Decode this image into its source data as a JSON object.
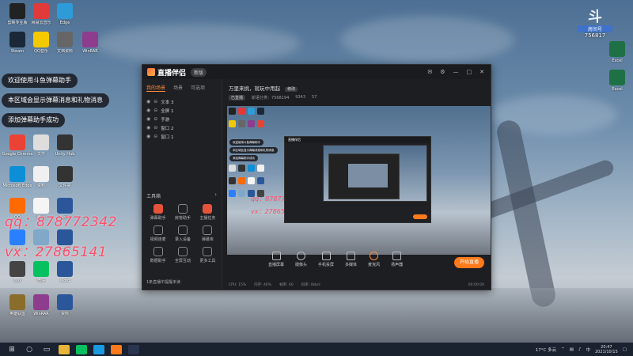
{
  "desktop": {
    "left_icons": [
      {
        "label": "剪映专业版",
        "color": "#222"
      },
      {
        "label": "网易云音乐",
        "color": "#e13a3a"
      },
      {
        "label": "Edge",
        "color": "#2d9bd8"
      },
      {
        "label": "Steam",
        "color": "#1b2838"
      },
      {
        "label": "QQ音乐",
        "color": "#f3c900"
      },
      {
        "label": "文档资料",
        "color": "#666"
      },
      {
        "label": "WinRAR",
        "color": "#8e3c8e"
      },
      {
        "label": "Google Chrome",
        "color": "#ea4335"
      },
      {
        "label": "文件",
        "color": "#ddd"
      },
      {
        "label": "Unity Hub",
        "color": "#333"
      },
      {
        "label": "Microsoft Edge",
        "color": "#0c8fd6"
      },
      {
        "label": "资料",
        "color": "#f0f0f0"
      },
      {
        "label": "文件夹",
        "color": "#333"
      },
      {
        "label": "QQ",
        "color": "#ff6a00"
      },
      {
        "label": "腾讯",
        "color": "#f5f5f5"
      },
      {
        "label": "Word",
        "color": "#2b579a"
      },
      {
        "label": "WPS",
        "color": "#2a7fff"
      },
      {
        "label": "文件",
        "color": "#7fa8c9"
      },
      {
        "label": "文档",
        "color": "#2b579a"
      },
      {
        "label": "游戏",
        "color": "#444"
      },
      {
        "label": "微信",
        "color": "#07c160"
      },
      {
        "label": "Word",
        "color": "#2b579a"
      },
      {
        "label": "英雄联盟",
        "color": "#8a6d2a"
      },
      {
        "label": "WinRAR",
        "color": "#8e3c8e"
      },
      {
        "label": "资料",
        "color": "#2b579a"
      }
    ],
    "right_icons": [
      {
        "label": "Excel",
        "color": "#1e7145"
      },
      {
        "label": "Excel",
        "color": "#1e7145"
      }
    ],
    "overlay_messages": [
      "欢迎使用斗鱼弹幕助手",
      "本区域会显示弹幕消息和礼物消息",
      "添加弹幕助手成功"
    ],
    "qq_line": "qq：878772342",
    "vx_line": "vx：27865141",
    "badge_label": "房间号",
    "badge_number": "756817"
  },
  "window": {
    "app_name": "直播伴侣",
    "version_tag": "新版",
    "title_icons": [
      "消息",
      "设置",
      "最小化",
      "最大化",
      "关闭"
    ],
    "left_tabs": [
      "我的场景",
      "场景",
      "可选项"
    ],
    "sources": [
      {
        "name": "文本 3"
      },
      {
        "name": "全屏 1"
      },
      {
        "name": "手游"
      },
      {
        "name": "窗口 2"
      },
      {
        "name": "窗口 1"
      }
    ],
    "tools_title": "工具箱",
    "tools": [
      {
        "label": "弹幕助手",
        "red": true
      },
      {
        "label": "房管助手",
        "red": false
      },
      {
        "label": "主播任务",
        "red": true
      },
      {
        "label": "视频连麦",
        "red": false
      },
      {
        "label": "录入设备",
        "red": false
      },
      {
        "label": "弹幕库",
        "red": false
      },
      {
        "label": "数据助手",
        "red": false
      },
      {
        "label": "全屏互动",
        "red": false
      },
      {
        "label": "更多工具",
        "red": false
      }
    ],
    "left_footer": "1条直播中提醒未读",
    "stream_title": "万里来挑，就玩中用起",
    "stream_tag": "修改",
    "stream_meta": [
      "已直播",
      "斯语分类：7568194",
      "9343",
      "57"
    ],
    "preview": {
      "bubbles": [
        "欢迎使用斗鱼弹幕助手",
        "本区域会显示弹幕消息和礼物消息",
        "添加弹幕助手成功"
      ],
      "qq": "qq：878772342",
      "vx": "vx：27865141"
    },
    "controls": [
      {
        "label": "直播屏幕"
      },
      {
        "label": "摄像头"
      },
      {
        "label": "手机投屏"
      },
      {
        "label": "多媒体"
      },
      {
        "label": "麦克风"
      },
      {
        "label": "扬声器"
      }
    ],
    "go_live": "开始直播",
    "status": [
      "CPU: 15%",
      "内存: 46%",
      "帧率: 60",
      "码率: 0kb/s"
    ],
    "status_time": "00:00:00"
  },
  "taskbar": {
    "start_glyph": "⊞",
    "weather": "17°C 多云",
    "ime": "中",
    "time": "20:47",
    "date": "2021/10/15"
  }
}
